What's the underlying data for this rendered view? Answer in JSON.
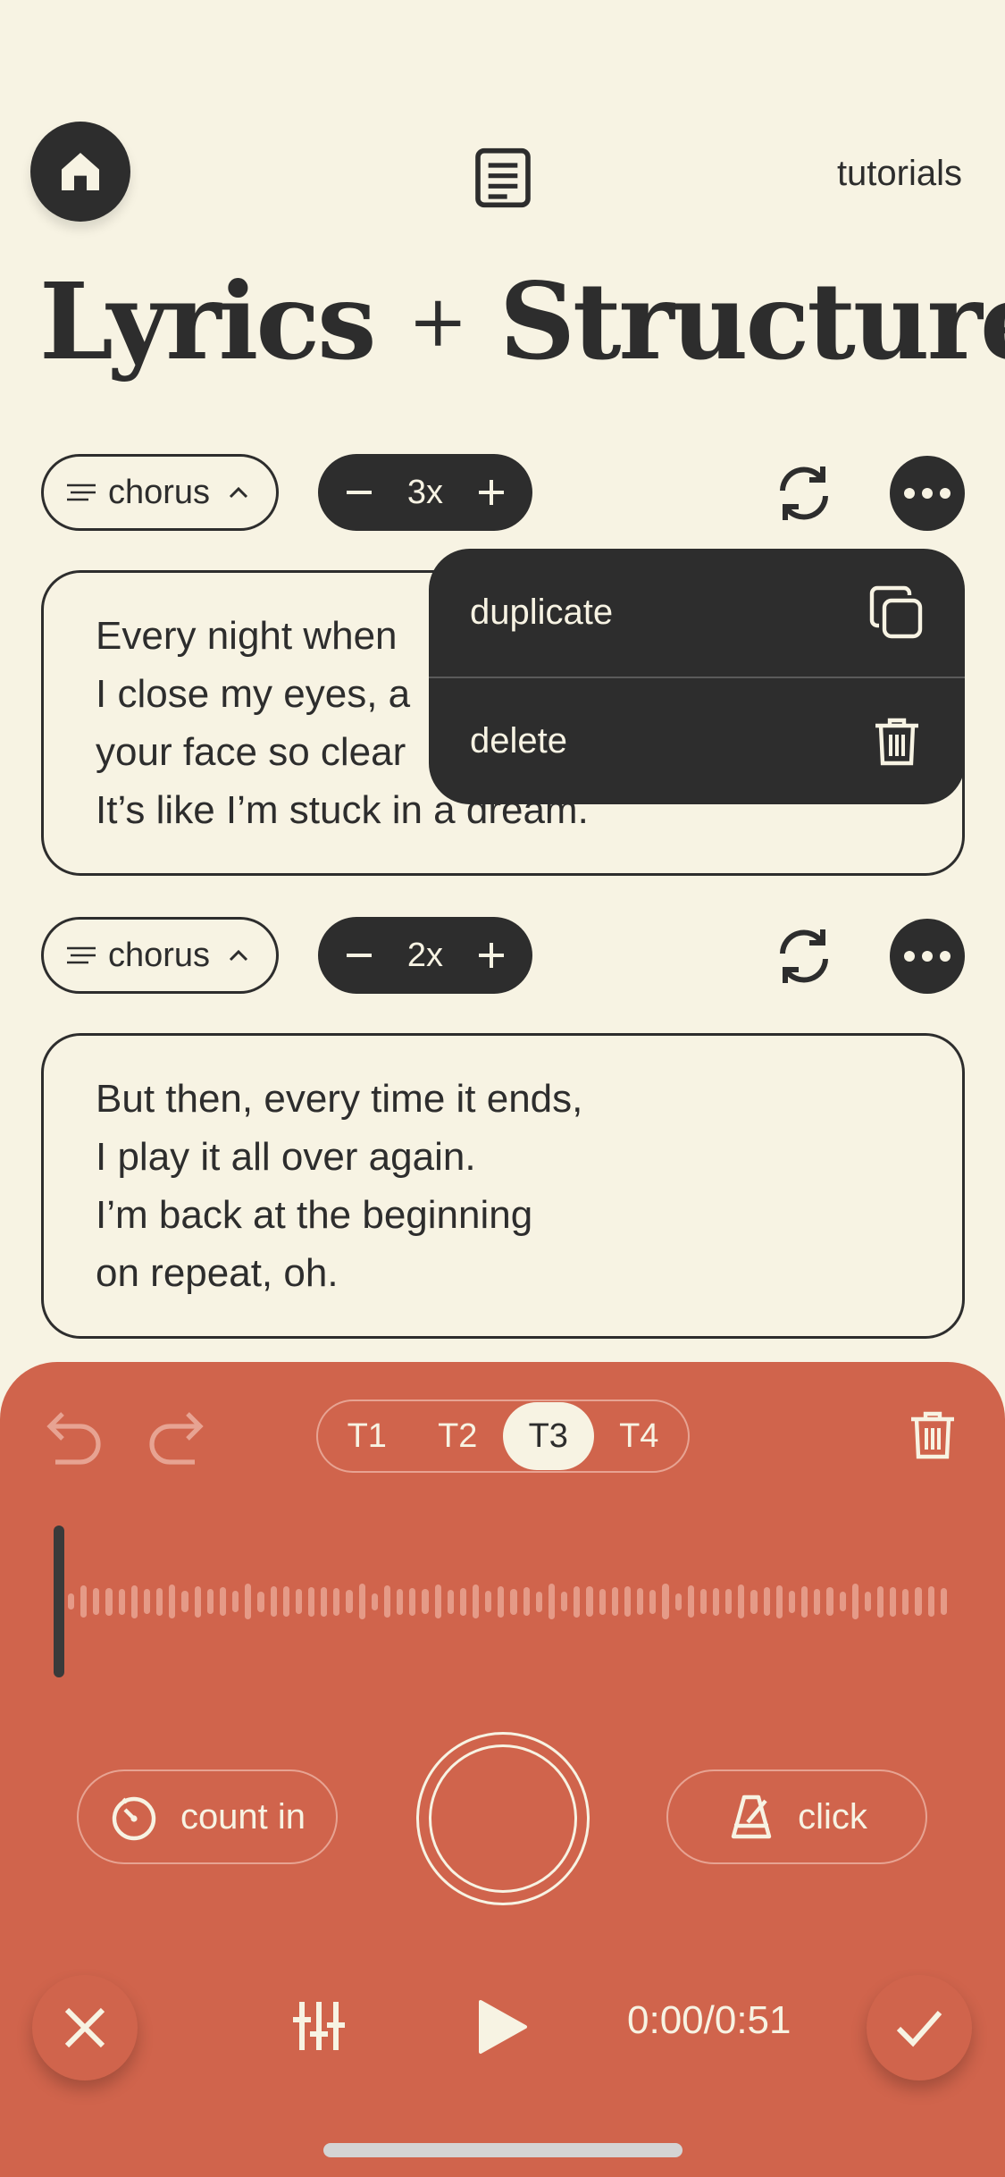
{
  "header": {
    "home_icon": "home-icon",
    "doc_icon": "document-icon",
    "tutorials_label": "tutorials",
    "title_part1": "Lyrics",
    "title_plus": "+",
    "title_part2": "Structure"
  },
  "sections": [
    {
      "label": "chorus",
      "repeat_count": "3x",
      "lines": [
        "Every night when",
        "I close my eyes, a",
        "your face so clear",
        "It’s like I’m stuck in a dream."
      ]
    },
    {
      "label": "chorus",
      "repeat_count": "2x",
      "lines": [
        "But then, every time it ends,",
        "I play it all over again.",
        "I’m back at the beginning",
        "on repeat, oh."
      ]
    }
  ],
  "menu": {
    "items": [
      {
        "label": "duplicate",
        "icon": "copy-icon"
      },
      {
        "label": "delete",
        "icon": "trash-icon"
      }
    ]
  },
  "recorder": {
    "tracks": [
      "T1",
      "T2",
      "T3",
      "T4"
    ],
    "active_track": "T3",
    "count_in_label": "count in",
    "click_label": "click",
    "time": "0:00/0:51"
  },
  "colors": {
    "background": "#f7f3e3",
    "dark": "#2d2d2d",
    "panel": "#d0644c"
  }
}
